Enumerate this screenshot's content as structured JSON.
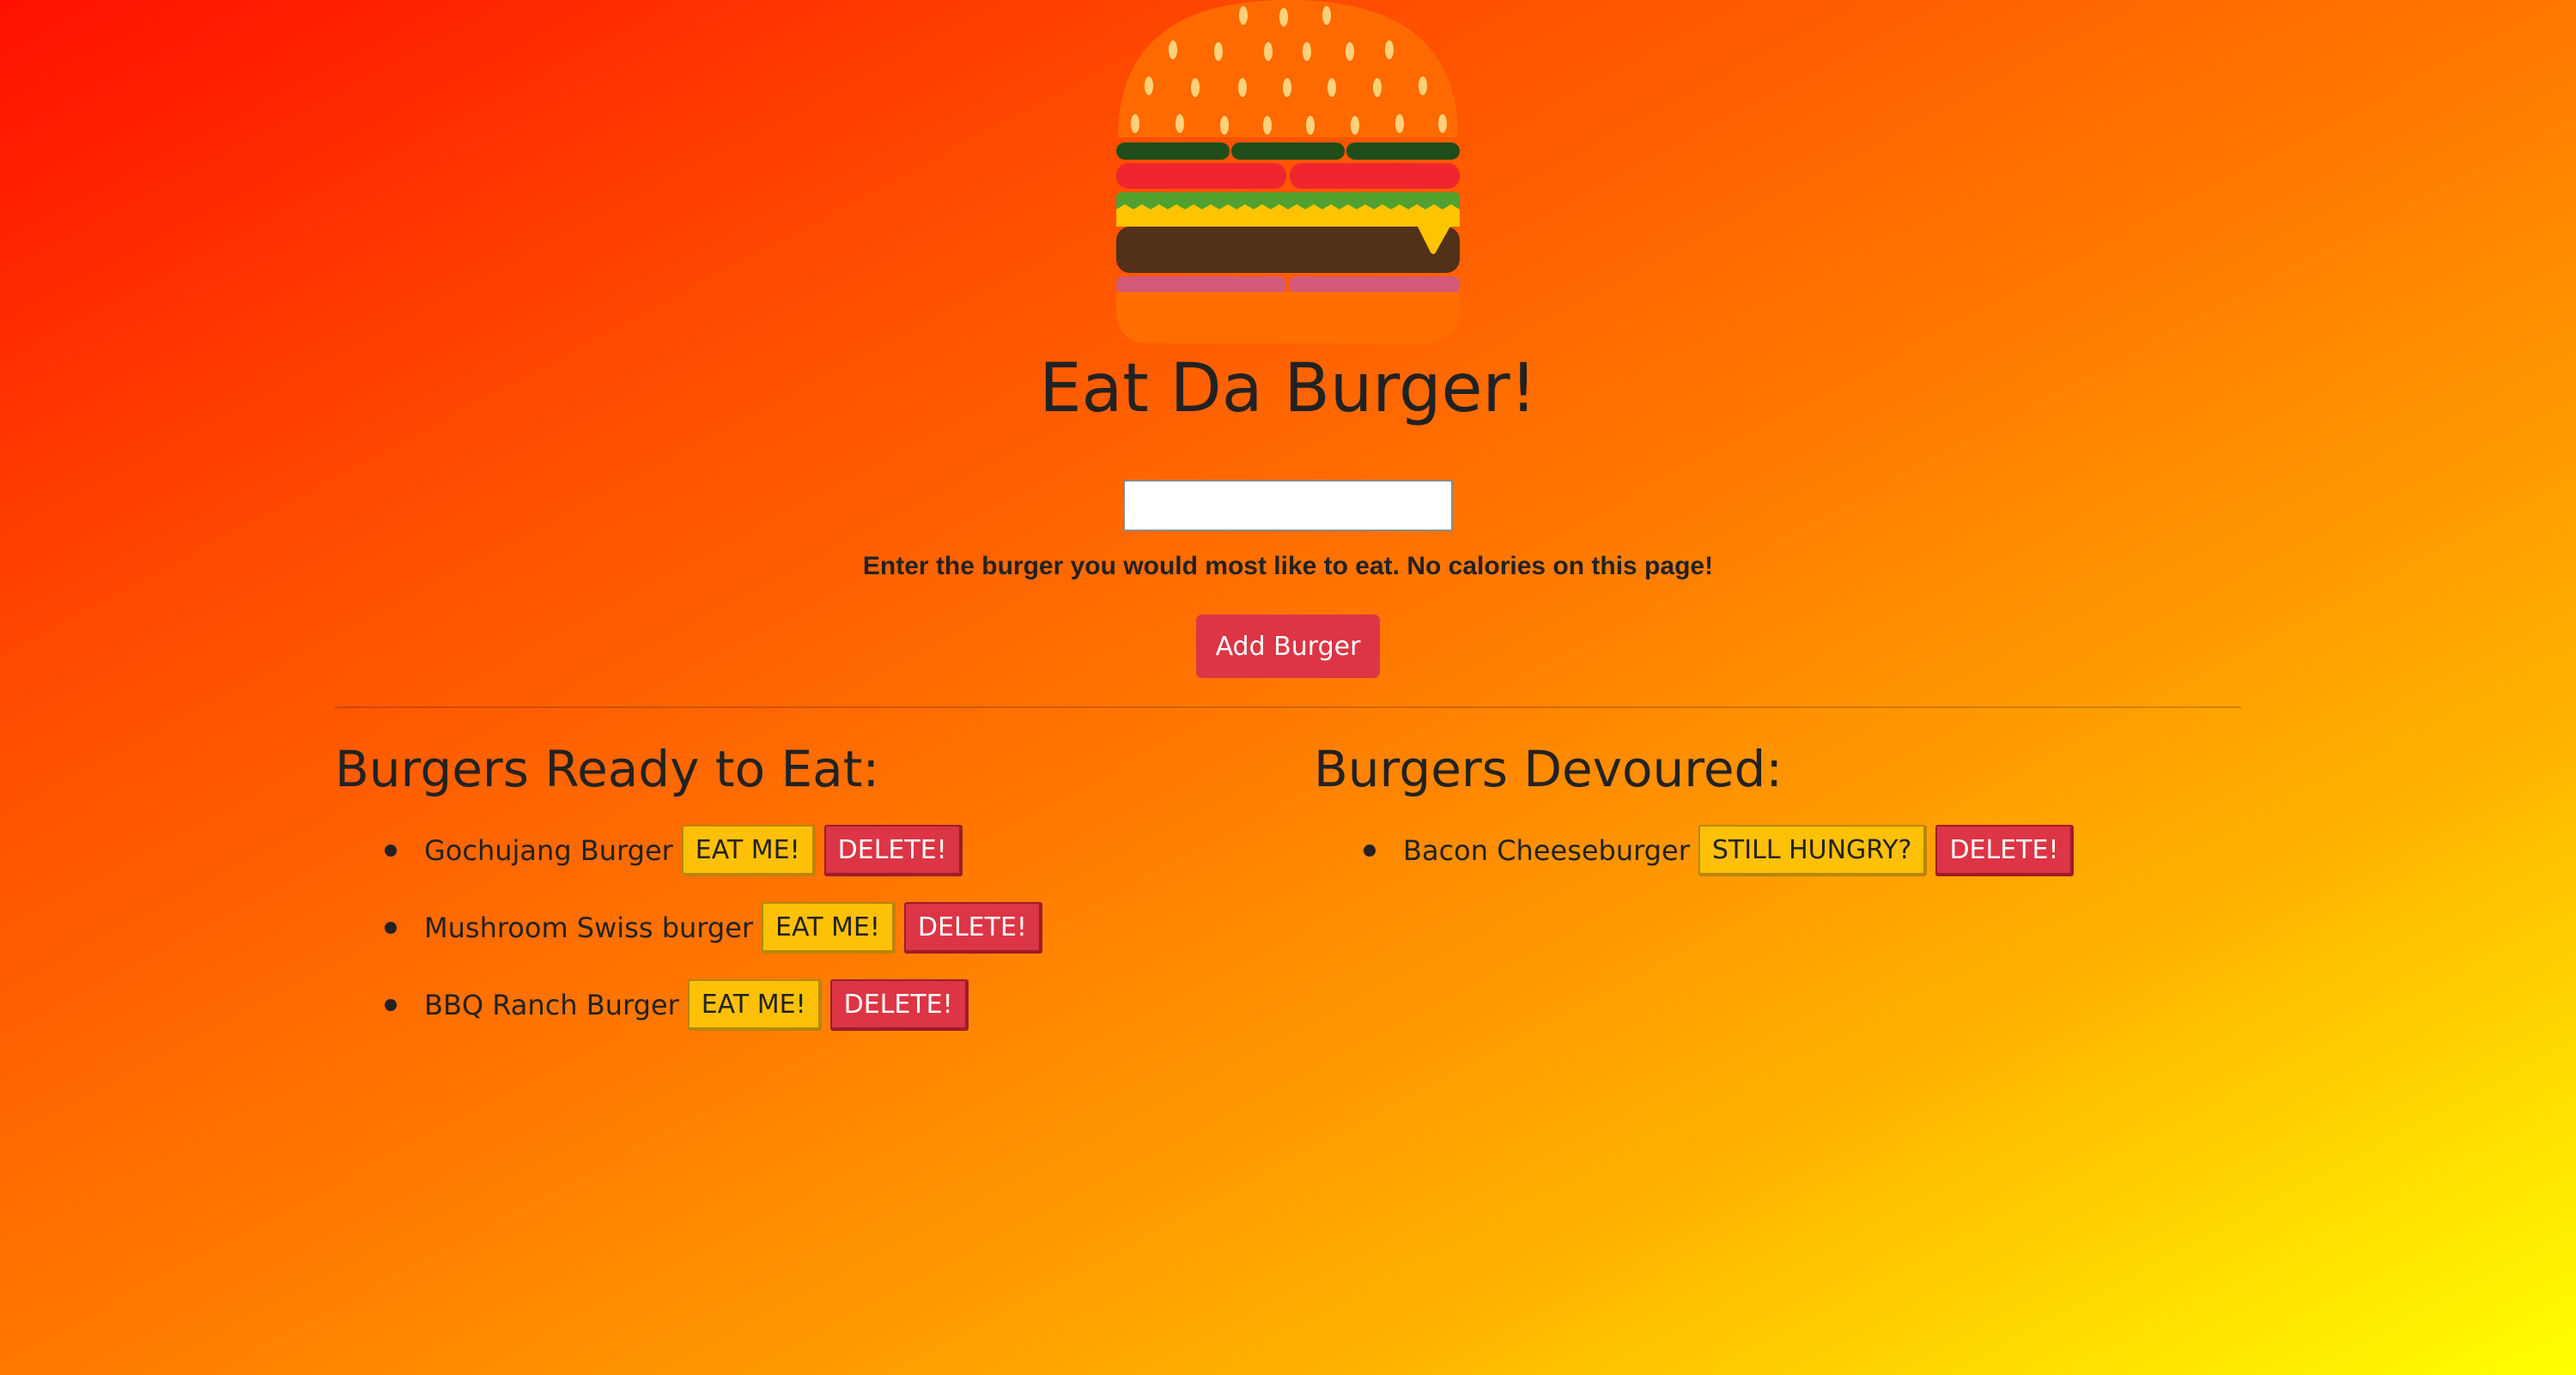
{
  "title": "Eat Da Burger!",
  "logo": {
    "icon": "burger-icon"
  },
  "form": {
    "input_value": "",
    "input_placeholder": "",
    "hint": "Enter the burger you would most like to eat. No calories on this page!",
    "add_button": "Add Burger"
  },
  "ready": {
    "heading": "Burgers Ready to Eat:",
    "items": [
      {
        "name": "Gochujang Burger",
        "action": "EAT ME!",
        "delete": "DELETE!"
      },
      {
        "name": "Mushroom Swiss burger",
        "action": "EAT ME!",
        "delete": "DELETE!"
      },
      {
        "name": "BBQ Ranch Burger",
        "action": "EAT ME!",
        "delete": "DELETE!"
      }
    ]
  },
  "devoured": {
    "heading": "Burgers Devoured:",
    "items": [
      {
        "name": "Bacon Cheeseburger",
        "action": "STILL HUNGRY?",
        "delete": "DELETE!"
      }
    ]
  },
  "colors": {
    "primary_red": "#dc3545",
    "eat_yellow": "#ffc107",
    "gradient_start": "#ff1000",
    "gradient_end": "#ffff00"
  }
}
